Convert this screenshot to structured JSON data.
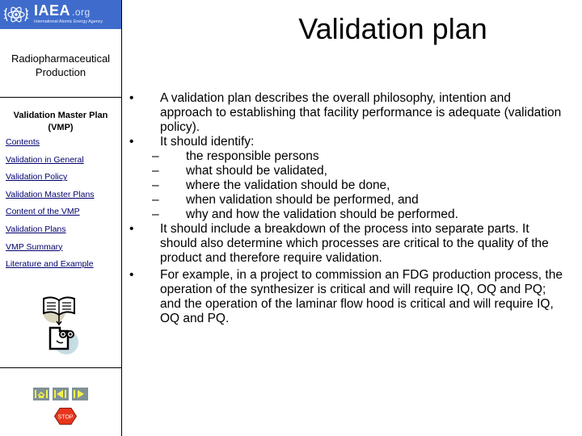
{
  "logo": {
    "name": "IAEA",
    "suffix": ".org",
    "subtitle": "International Atomic Energy Agency",
    "brand_color": "#3f6ccc"
  },
  "sidebar": {
    "section_title_line1": "Radiopharmaceutical",
    "section_title_line2": "Production",
    "nav_title_line1": "Validation Master Plan",
    "nav_title_line2": "(VMP)",
    "link_color": "#00006e",
    "items": [
      {
        "label": "Contents"
      },
      {
        "label": "Validation in General"
      },
      {
        "label": "Validation Policy"
      },
      {
        "label": "Validation Master Plans"
      },
      {
        "label": "Content of the VMP"
      },
      {
        "label": "Validation Plans"
      },
      {
        "label": "VMP Summary"
      },
      {
        "label": "Literature and Example"
      }
    ],
    "illustration_icon": "book-to-document-icon",
    "controls": {
      "home_icon": "home-icon",
      "back_icon": "back-icon",
      "forward_icon": "forward-icon",
      "stop_label": "STOP",
      "stop_color": "#e8361c"
    }
  },
  "slide": {
    "title": "Validation plan",
    "bullet_marker": "•",
    "sub_marker": "–",
    "bullets": [
      {
        "text": "A validation plan describes the overall philosophy, intention and approach to establishing that facility performance is adequate (validation policy)."
      },
      {
        "text": "It should identify:"
      },
      {
        "text": "It should include a breakdown of the process into separate parts. It should also determine which processes are critical to the quality of the product and therefore require validation."
      },
      {
        "text": "For example, in a project to commission an FDG production process, the operation of the synthesizer is critical and will require IQ, OQ and PQ; and the operation of the laminar flow hood is critical and will require IQ, OQ and PQ."
      }
    ],
    "sub_items": [
      {
        "text": "the responsible persons"
      },
      {
        "text": "what should be validated,"
      },
      {
        "text": "where the validation should be done,"
      },
      {
        "text": "when validation should be performed, and"
      },
      {
        "text": "why and how the validation should be performed."
      }
    ]
  }
}
